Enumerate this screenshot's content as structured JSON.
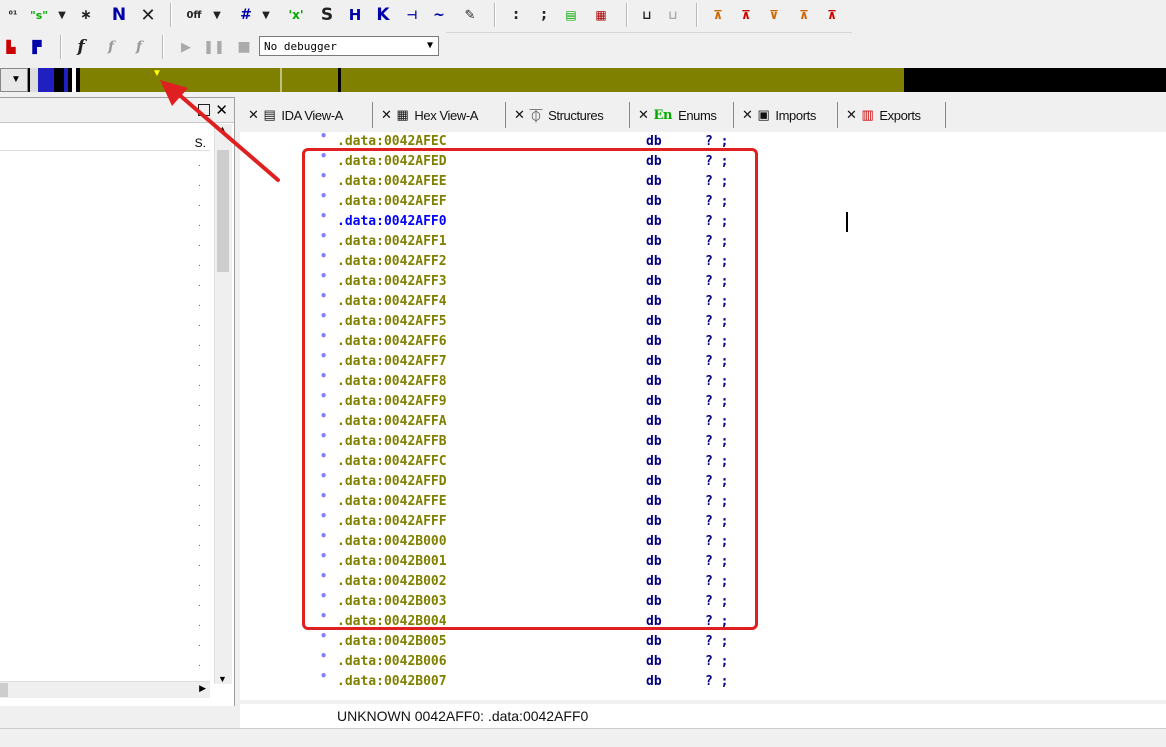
{
  "toolbar": {
    "debugger_select": "No debugger"
  },
  "tabs": [
    {
      "label": "IDA View-A",
      "icon": "ida-view-icon"
    },
    {
      "label": "Hex View-A",
      "icon": "hex-view-icon"
    },
    {
      "label": "Structures",
      "icon": "structures-icon"
    },
    {
      "label": "Enums",
      "icon": "enums-icon",
      "icon_text": "En"
    },
    {
      "label": "Imports",
      "icon": "imports-icon"
    },
    {
      "label": "Exports",
      "icon": "exports-icon"
    }
  ],
  "left_panel": {
    "column_header": "S."
  },
  "code_view": {
    "current_address": ".data:0042AFF0",
    "rows": [
      {
        "addr": ".data:0042AFEC",
        "op": "db",
        "val": "? ;"
      },
      {
        "addr": ".data:0042AFED",
        "op": "db",
        "val": "? ;"
      },
      {
        "addr": ".data:0042AFEE",
        "op": "db",
        "val": "? ;"
      },
      {
        "addr": ".data:0042AFEF",
        "op": "db",
        "val": "? ;"
      },
      {
        "addr": ".data:0042AFF0",
        "op": "db",
        "val": "? ;"
      },
      {
        "addr": ".data:0042AFF1",
        "op": "db",
        "val": "? ;"
      },
      {
        "addr": ".data:0042AFF2",
        "op": "db",
        "val": "? ;"
      },
      {
        "addr": ".data:0042AFF3",
        "op": "db",
        "val": "? ;"
      },
      {
        "addr": ".data:0042AFF4",
        "op": "db",
        "val": "? ;"
      },
      {
        "addr": ".data:0042AFF5",
        "op": "db",
        "val": "? ;"
      },
      {
        "addr": ".data:0042AFF6",
        "op": "db",
        "val": "? ;"
      },
      {
        "addr": ".data:0042AFF7",
        "op": "db",
        "val": "? ;"
      },
      {
        "addr": ".data:0042AFF8",
        "op": "db",
        "val": "? ;"
      },
      {
        "addr": ".data:0042AFF9",
        "op": "db",
        "val": "? ;"
      },
      {
        "addr": ".data:0042AFFA",
        "op": "db",
        "val": "? ;"
      },
      {
        "addr": ".data:0042AFFB",
        "op": "db",
        "val": "? ;"
      },
      {
        "addr": ".data:0042AFFC",
        "op": "db",
        "val": "? ;"
      },
      {
        "addr": ".data:0042AFFD",
        "op": "db",
        "val": "? ;"
      },
      {
        "addr": ".data:0042AFFE",
        "op": "db",
        "val": "? ;"
      },
      {
        "addr": ".data:0042AFFF",
        "op": "db",
        "val": "? ;"
      },
      {
        "addr": ".data:0042B000",
        "op": "db",
        "val": "? ;"
      },
      {
        "addr": ".data:0042B001",
        "op": "db",
        "val": "? ;"
      },
      {
        "addr": ".data:0042B002",
        "op": "db",
        "val": "? ;"
      },
      {
        "addr": ".data:0042B003",
        "op": "db",
        "val": "? ;"
      },
      {
        "addr": ".data:0042B004",
        "op": "db",
        "val": "? ;"
      },
      {
        "addr": ".data:0042B005",
        "op": "db",
        "val": "? ;"
      },
      {
        "addr": ".data:0042B006",
        "op": "db",
        "val": "? ;"
      },
      {
        "addr": ".data:0042B007",
        "op": "db",
        "val": "? ;"
      }
    ]
  },
  "status_line": "UNKNOWN 0042AFF0: .data:0042AFF0",
  "colors": {
    "address": "#808000",
    "current_address": "#0000ff",
    "mnemonic": "#000080",
    "annotation": "#e02020",
    "nav_data": "#808000"
  }
}
